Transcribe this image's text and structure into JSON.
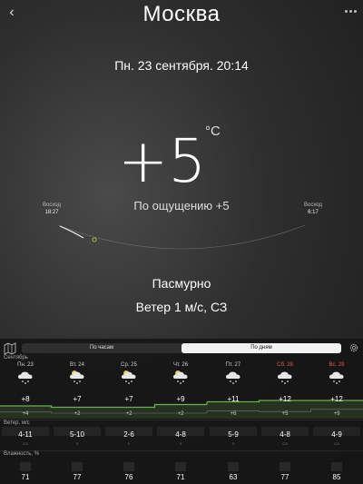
{
  "header": {
    "city": "Москва",
    "datetime": "Пн. 23 сентября. 20:14"
  },
  "current": {
    "temp": "+5",
    "unit": "°C",
    "feels_like": "По ощущению +5",
    "sunrise_label": "Восход",
    "sunrise_time": "18:27",
    "sunset_label": "Восход",
    "sunset_time": "6:17",
    "condition": "Пасмурно",
    "wind": "Ветер 1 м/с, СЗ"
  },
  "panel": {
    "tabs": [
      "По часам",
      "По дням"
    ],
    "active_tab": 1,
    "month": "Сентябрь",
    "days": [
      {
        "label": "Пн. 23",
        "weekend": false,
        "icon": "snow-cloud-icon",
        "max": "+8",
        "min": "+4",
        "wind": "4-11",
        "wind_dir": "СЗ",
        "humidity": "71"
      },
      {
        "label": "Вт. 24",
        "weekend": false,
        "icon": "partly-cloudy-snow-icon",
        "max": "+7",
        "min": "+2",
        "wind": "5-10",
        "wind_dir": "З",
        "humidity": "77"
      },
      {
        "label": "Ср. 25",
        "weekend": false,
        "icon": "partly-cloudy-snow-icon",
        "max": "+7",
        "min": "+2",
        "wind": "2-6",
        "wind_dir": "З",
        "humidity": "76"
      },
      {
        "label": "Чт. 26",
        "weekend": false,
        "icon": "partly-cloudy-snow-icon",
        "max": "+9",
        "min": "+2",
        "wind": "4-8",
        "wind_dir": "З",
        "humidity": "71"
      },
      {
        "label": "Пт. 27",
        "weekend": false,
        "icon": "snow-cloud-icon",
        "max": "+11",
        "min": "+6",
        "wind": "5-9",
        "wind_dir": "З",
        "humidity": "63"
      },
      {
        "label": "Сб. 28",
        "weekend": true,
        "icon": "snow-cloud-icon",
        "max": "+12",
        "min": "+5",
        "wind": "4-8",
        "wind_dir": "СЗ",
        "humidity": "77"
      },
      {
        "label": "Вс. 29",
        "weekend": true,
        "icon": "snow-cloud-icon",
        "max": "+12",
        "min": "+9",
        "wind": "4-9",
        "wind_dir": "СЗ",
        "humidity": "85"
      }
    ],
    "wind_label": "Ветер, м/с",
    "humidity_label": "Влажность, %",
    "colors": {
      "accent_green": "#6ab04c",
      "weekend_red": "#e05a4a"
    }
  }
}
